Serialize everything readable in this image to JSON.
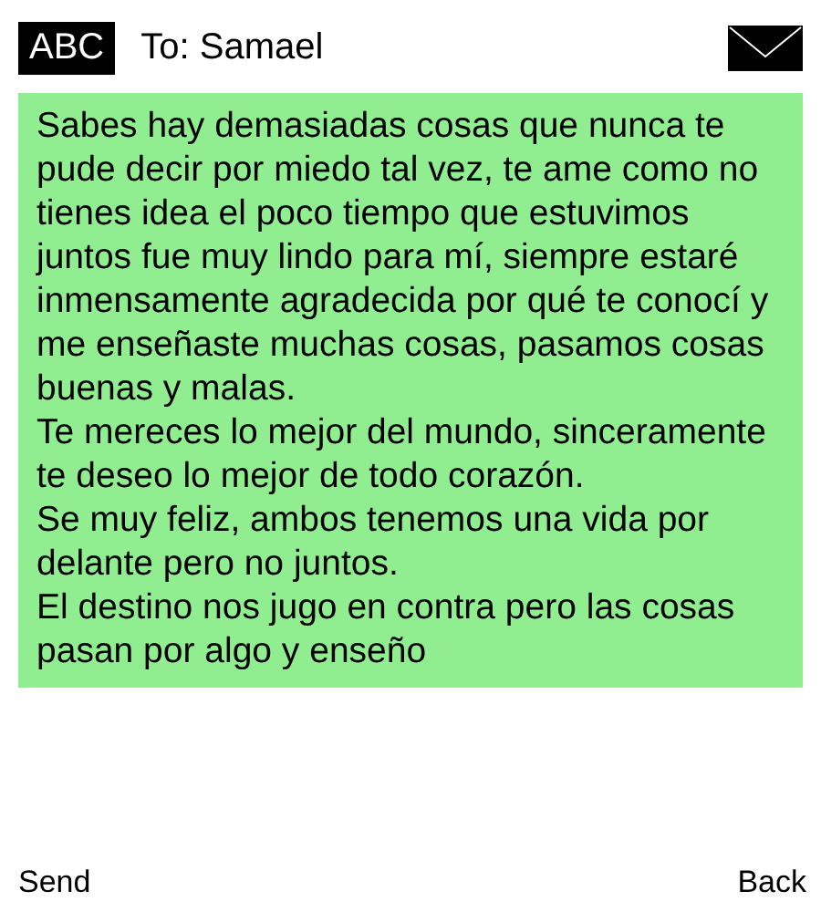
{
  "header": {
    "input_mode": "ABC",
    "recipient": "To: Samael"
  },
  "message": {
    "paragraphs": [
      "Sabes hay demasiadas cosas que nunca te pude decir por miedo tal vez, te ame como no tienes idea el poco tiempo que estuvimos juntos fue muy lindo para mí, siempre estaré inmensamente agradecida por qué te conocí y me enseñaste muchas cosas, pasamos cosas buenas y malas.",
      "Te mereces lo mejor del mundo, sinceramente te deseo lo mejor de todo corazón.",
      "Se muy feliz, ambos tenemos una vida por delante pero no juntos.",
      "El destino nos jugo en contra pero las cosas pasan por algo y enseño"
    ]
  },
  "softkeys": {
    "left": "Send",
    "right": "Back"
  }
}
